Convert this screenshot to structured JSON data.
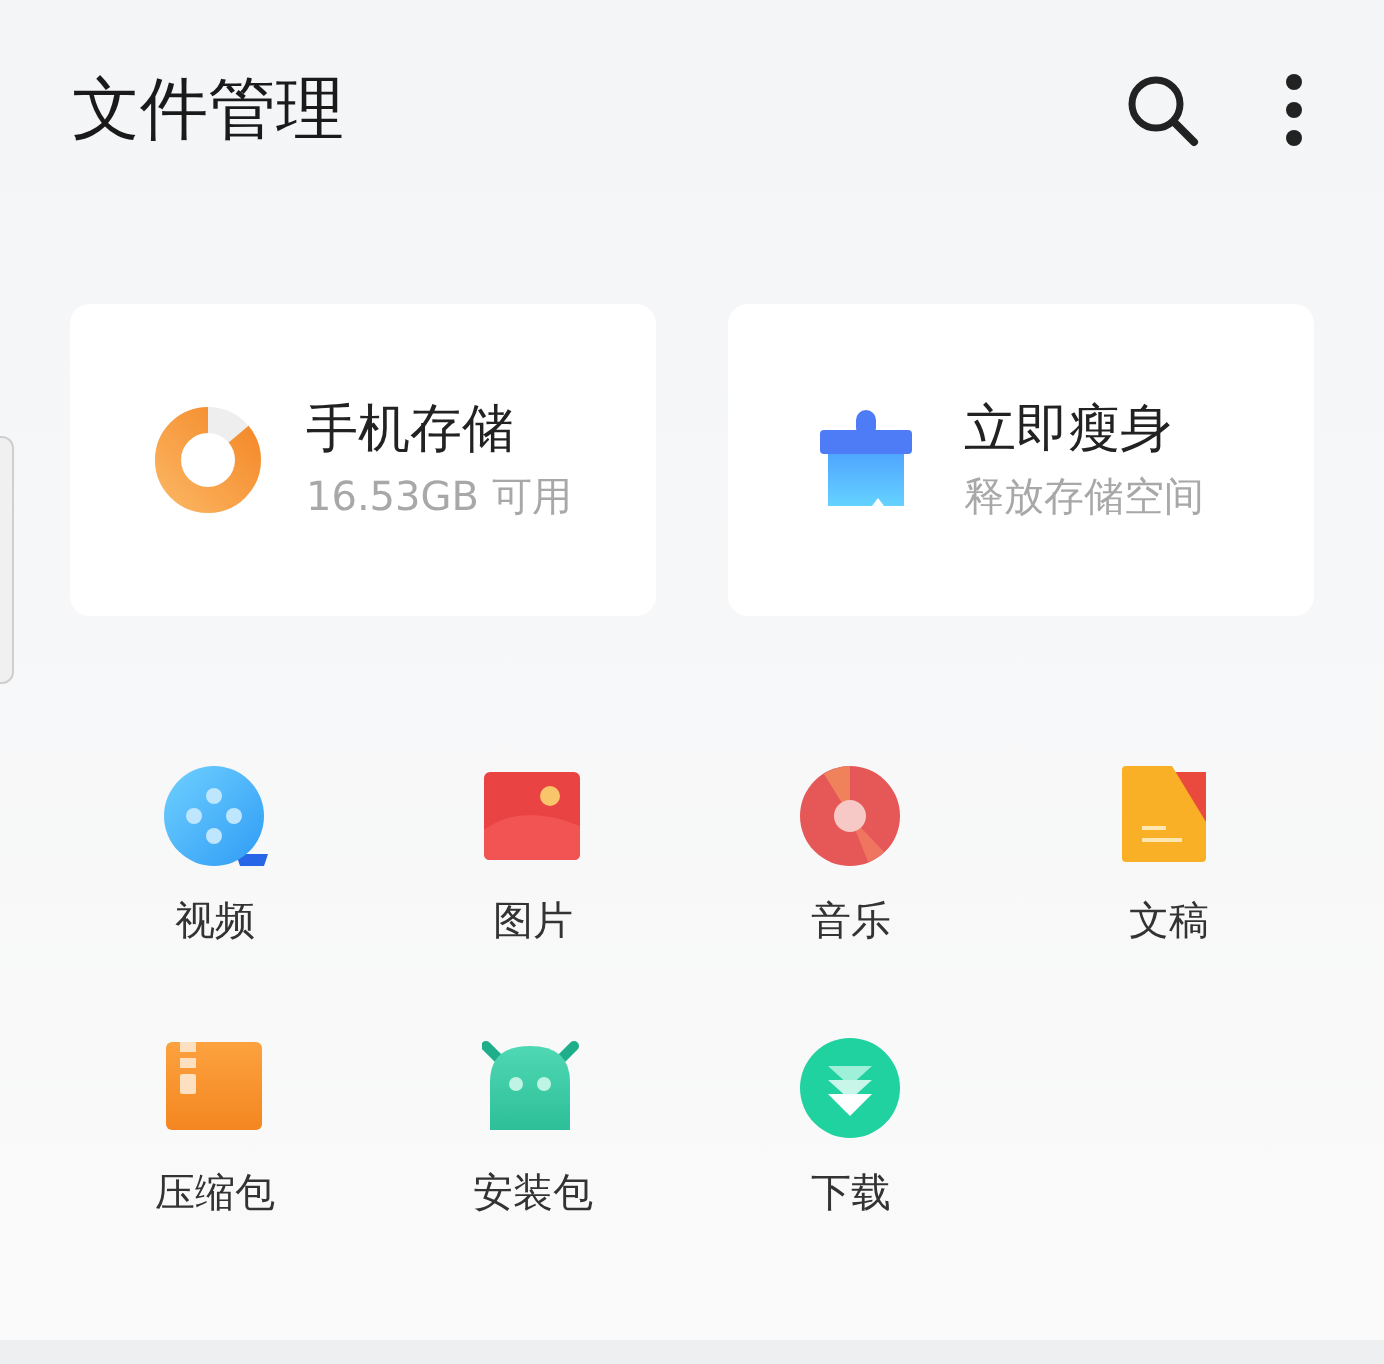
{
  "header": {
    "title": "文件管理"
  },
  "cards": [
    {
      "kind": "storage",
      "title": "手机存储",
      "subtitle": "16.53GB 可用",
      "level": 0.86
    },
    {
      "kind": "cleanup",
      "title": "立即瘦身",
      "subtitle": "释放存储空间"
    }
  ],
  "categories": [
    {
      "kind": "video",
      "label": "视频"
    },
    {
      "kind": "image",
      "label": "图片"
    },
    {
      "kind": "music",
      "label": "音乐"
    },
    {
      "kind": "document",
      "label": "文稿"
    },
    {
      "kind": "archive",
      "label": "压缩包"
    },
    {
      "kind": "apk",
      "label": "安装包"
    },
    {
      "kind": "download",
      "label": "下载"
    }
  ]
}
